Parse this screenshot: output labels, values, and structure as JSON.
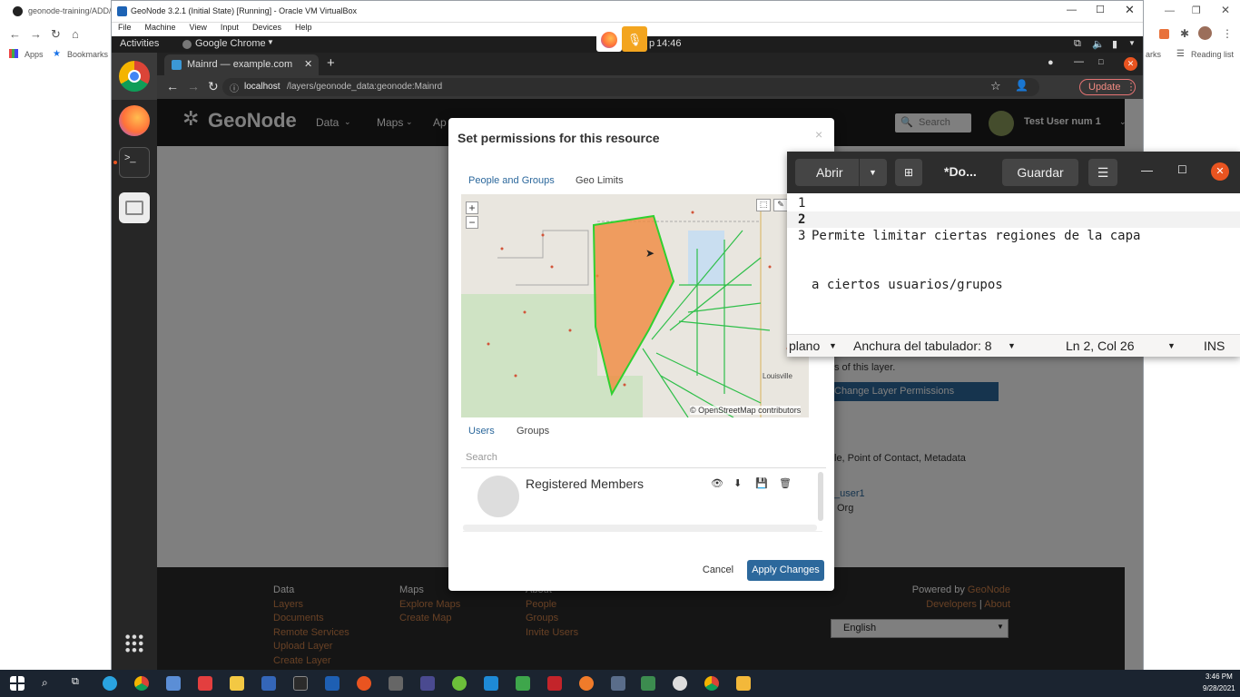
{
  "host": {
    "tab_title": "geonode-training/ADD/",
    "bookmarks": [
      "Apps",
      "Bookmarks"
    ],
    "right_bookmarks": [
      "arks",
      "Reading list"
    ]
  },
  "vbox": {
    "title": "GeoNode 3.2.1 (Initial State) [Running] - Oracle VM VirtualBox",
    "menu": [
      "File",
      "Machine",
      "View",
      "Input",
      "Devices",
      "Help"
    ]
  },
  "gnome": {
    "activities": "Activities",
    "app_menu": "Google Chrome",
    "clock": "14:46",
    "clock_prefix": "p"
  },
  "browser": {
    "tab_title": "Mainrd — example.com",
    "url_host": "localhost",
    "url_path": "/layers/geonode_data:geonode:Mainrd",
    "update_label": "Update"
  },
  "geonode": {
    "logo": "GeoNode",
    "nav": [
      "Data",
      "Maps",
      "Ap"
    ],
    "search_placeholder": "Search",
    "user": "Test User num 1",
    "page_text": {
      "layer_note": "s of this layer.",
      "change_perms": "Change Layer Permissions",
      "contacts": "le, Point of Contact, Metadata",
      "user_link": "_user1",
      "org": "Org"
    },
    "footer": {
      "data_head": "Data",
      "data_links": [
        "Layers",
        "Documents",
        "Remote Services",
        "Upload Layer",
        "Create Layer"
      ],
      "maps_head": "Maps",
      "maps_links": [
        "Explore Maps",
        "Create Map"
      ],
      "about_head": "About",
      "about_links": [
        "People",
        "Groups",
        "Invite Users"
      ],
      "powered_by": "Powered by",
      "powered_link": "GeoNode",
      "developers": "Developers",
      "about": "About",
      "language": "English"
    }
  },
  "modal": {
    "title": "Set permissions for this resource",
    "tabs": [
      "People and Groups",
      "Geo Limits"
    ],
    "map_attribution": "© OpenStreetMap contributors",
    "map_place": "Louisville",
    "sub_tabs": [
      "Users",
      "Groups"
    ],
    "search_placeholder": "Search",
    "member": "Registered Members",
    "cancel": "Cancel",
    "apply": "Apply Changes"
  },
  "gedit": {
    "open": "Abrir",
    "title": "*Do...",
    "save": "Guardar",
    "lines": [
      {
        "n": "1",
        "text": "Permite limitar ciertas regiones de la capa"
      },
      {
        "n": "2",
        "text": "a ciertos usuarios/grupos"
      },
      {
        "n": "3",
        "text": ""
      }
    ],
    "status_mode": "plano",
    "status_tab": "Anchura del tabulador: 8",
    "status_pos": "Ln 2, Col 26",
    "status_ins": "INS"
  },
  "taskbar": {
    "time": "3:46 PM",
    "date": "9/28/2021"
  }
}
